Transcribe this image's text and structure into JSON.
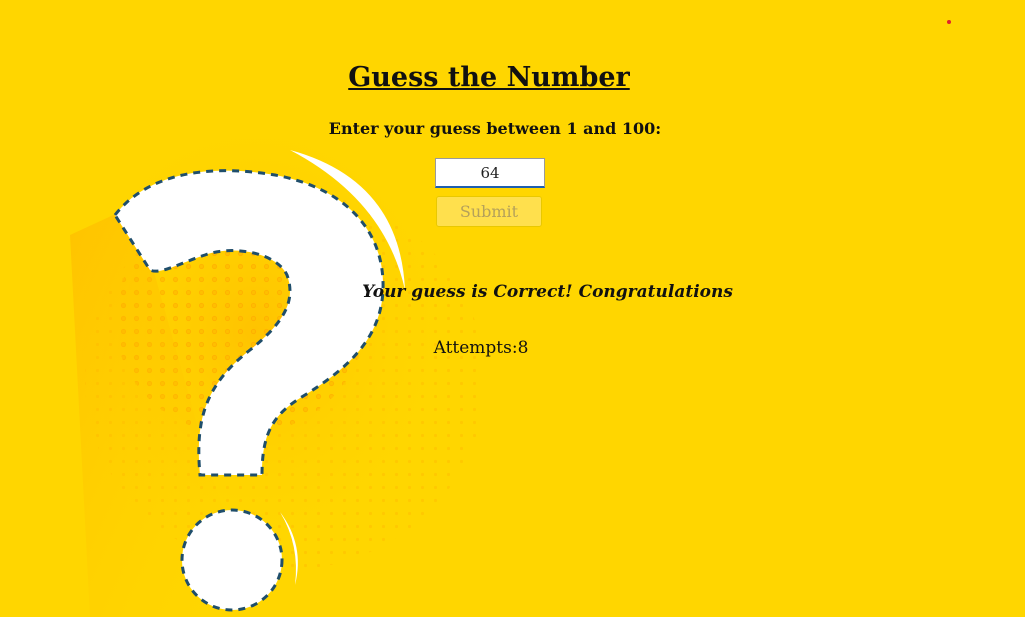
{
  "page": {
    "title": "Guess the Number",
    "prompt": "Enter your guess between 1 and 100:"
  },
  "guess_input": {
    "value": "64"
  },
  "submit_button": {
    "label": "Submit",
    "state": "disabled"
  },
  "result": {
    "message": "Your guess is Correct! Congratulations"
  },
  "attempts": {
    "text": "Attempts:8"
  },
  "decorations": {
    "background_icon": "question-mark-icon",
    "background_color": "#FFD600",
    "marker_color": "#E0232B"
  }
}
